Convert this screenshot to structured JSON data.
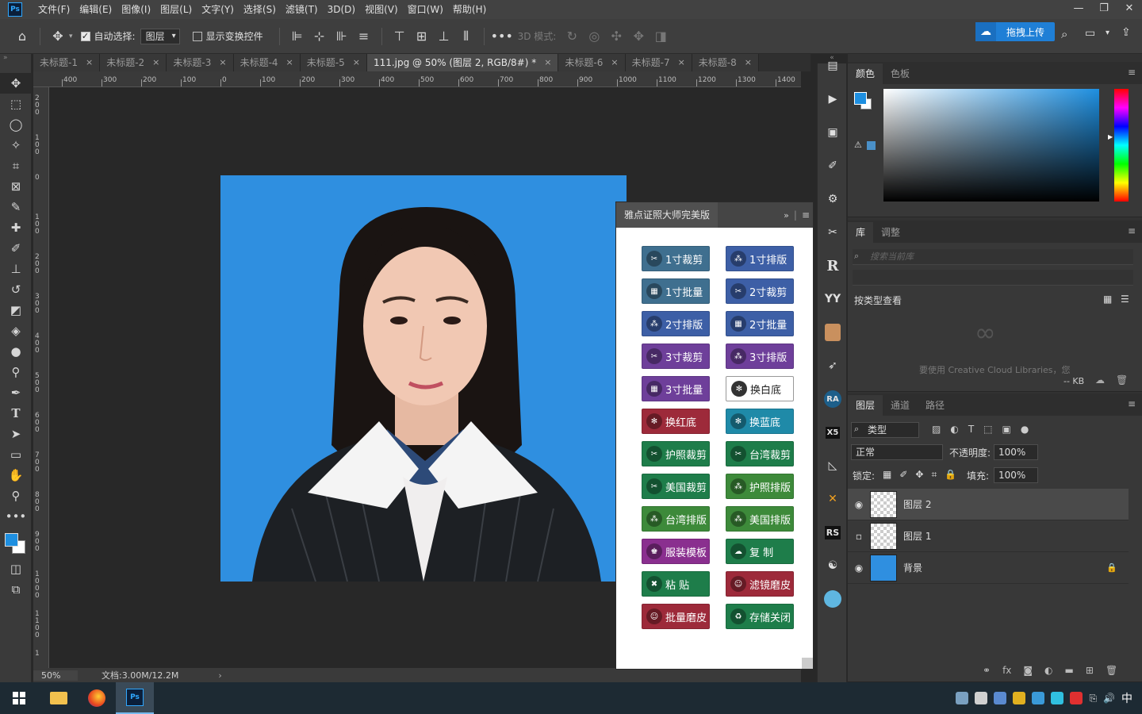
{
  "app": {
    "logo": "Ps",
    "menu": [
      "文件(F)",
      "编辑(E)",
      "图像(I)",
      "图层(L)",
      "文字(Y)",
      "选择(S)",
      "滤镜(T)",
      "3D(D)",
      "视图(V)",
      "窗口(W)",
      "帮助(H)"
    ],
    "window_controls": [
      "—",
      "❐",
      "✕"
    ]
  },
  "options": {
    "auto_select_label": "自动选择:",
    "auto_select_value": "图层",
    "show_transform_label": "显示变换控件",
    "mode_3d_label": "3D 模式:",
    "cloud_upload_label": "拖拽上传"
  },
  "tabs": [
    {
      "label": "未标题-1",
      "active": false
    },
    {
      "label": "未标题-2",
      "active": false
    },
    {
      "label": "未标题-3",
      "active": false
    },
    {
      "label": "未标题-4",
      "active": false
    },
    {
      "label": "未标题-5",
      "active": false
    },
    {
      "label": "111.jpg @ 50% (图层 2, RGB/8#) *",
      "active": true
    },
    {
      "label": "未标题-6",
      "active": false
    },
    {
      "label": "未标题-7",
      "active": false
    },
    {
      "label": "未标题-8",
      "active": false
    }
  ],
  "ruler": {
    "h_labels": [
      "400",
      "300",
      "200",
      "100",
      "0",
      "100",
      "200",
      "300",
      "400",
      "500",
      "600",
      "700",
      "800",
      "900",
      "1000",
      "1100",
      "1200",
      "1300",
      "1400"
    ],
    "v_labels": [
      "200",
      "100",
      "0",
      "100",
      "200",
      "300",
      "400",
      "500",
      "600",
      "700",
      "800",
      "900",
      "1000",
      "1100",
      "1"
    ]
  },
  "status": {
    "zoom": "50%",
    "doc": "文档:3.00M/12.2M"
  },
  "plugin": {
    "title": "雅点证照大师完美版",
    "buttons": [
      {
        "label": "1寸裁剪",
        "color": "slate",
        "icon": "scissors-icon"
      },
      {
        "label": "1寸排版",
        "color": "blue",
        "icon": "grid-icon"
      },
      {
        "label": "1寸批量",
        "color": "slate",
        "icon": "batch-icon"
      },
      {
        "label": "2寸裁剪",
        "color": "blue",
        "icon": "scissors-icon"
      },
      {
        "label": "2寸排版",
        "color": "blue",
        "icon": "grid-icon"
      },
      {
        "label": "2寸批量",
        "color": "blue",
        "icon": "batch-icon"
      },
      {
        "label": "3寸裁剪",
        "color": "purple",
        "icon": "scissors-icon"
      },
      {
        "label": "3寸排版",
        "color": "purple",
        "icon": "grid-icon"
      },
      {
        "label": "3寸批量",
        "color": "purple",
        "icon": "batch-icon"
      },
      {
        "label": "换白底",
        "color": "white",
        "icon": "swap-icon"
      },
      {
        "label": "换红底",
        "color": "red",
        "icon": "swap-icon"
      },
      {
        "label": "换蓝底",
        "color": "teal",
        "icon": "swap-icon"
      },
      {
        "label": "护照裁剪",
        "color": "green",
        "icon": "scissors-icon"
      },
      {
        "label": "台湾裁剪",
        "color": "green",
        "icon": "scissors-icon"
      },
      {
        "label": "美国裁剪",
        "color": "green",
        "icon": "scissors-icon"
      },
      {
        "label": "护照排版",
        "color": "olive",
        "icon": "grid-icon"
      },
      {
        "label": "台湾排版",
        "color": "olive",
        "icon": "grid-icon"
      },
      {
        "label": "美国排版",
        "color": "olive",
        "icon": "grid-icon"
      },
      {
        "label": "服装模板",
        "color": "violet",
        "icon": "suit-icon"
      },
      {
        "label": "复 制",
        "color": "green",
        "icon": "copy-icon"
      },
      {
        "label": "粘 贴",
        "color": "green",
        "icon": "paste-icon"
      },
      {
        "label": "滤镜磨皮",
        "color": "red",
        "icon": "person-icon"
      },
      {
        "label": "批量磨皮",
        "color": "red",
        "icon": "person-icon"
      },
      {
        "label": "存储关闭",
        "color": "green",
        "icon": "save-icon"
      }
    ]
  },
  "right_icons": [
    "hist-icon",
    "play-icon",
    "adjust-icon",
    "brush-icon",
    "sliders-icon",
    "scissors-icon",
    "R",
    "YY",
    "avatar-icon",
    "bird-icon",
    "RA",
    "X5",
    "ruler-icon",
    "cross-icon",
    "RS",
    "yin-icon",
    "face-icon"
  ],
  "color_panel": {
    "tabs": [
      "颜色",
      "色板"
    ],
    "foreground": "#1e8fe0",
    "background": "#ffffff"
  },
  "library_panel": {
    "tabs": [
      "库",
      "调整"
    ],
    "search_placeholder": "搜索当前库",
    "view_by": "按类型查看",
    "cc_text": "要使用 Creative Cloud Libraries，您",
    "size": "-- KB"
  },
  "layers_panel": {
    "tabs": [
      "图层",
      "通道",
      "路径"
    ],
    "filter_label": "类型",
    "blend_mode": "正常",
    "opacity_label": "不透明度:",
    "opacity_value": "100%",
    "lock_label": "锁定:",
    "fill_label": "填充:",
    "fill_value": "100%",
    "layers": [
      {
        "name": "图层 2",
        "visible": true,
        "selected": true,
        "thumb": "check"
      },
      {
        "name": "图层 1",
        "visible": false,
        "selected": false,
        "thumb": "check"
      },
      {
        "name": "背景",
        "visible": true,
        "selected": false,
        "thumb": "bg",
        "locked": true
      }
    ]
  },
  "taskbar": {
    "ime": "中"
  }
}
